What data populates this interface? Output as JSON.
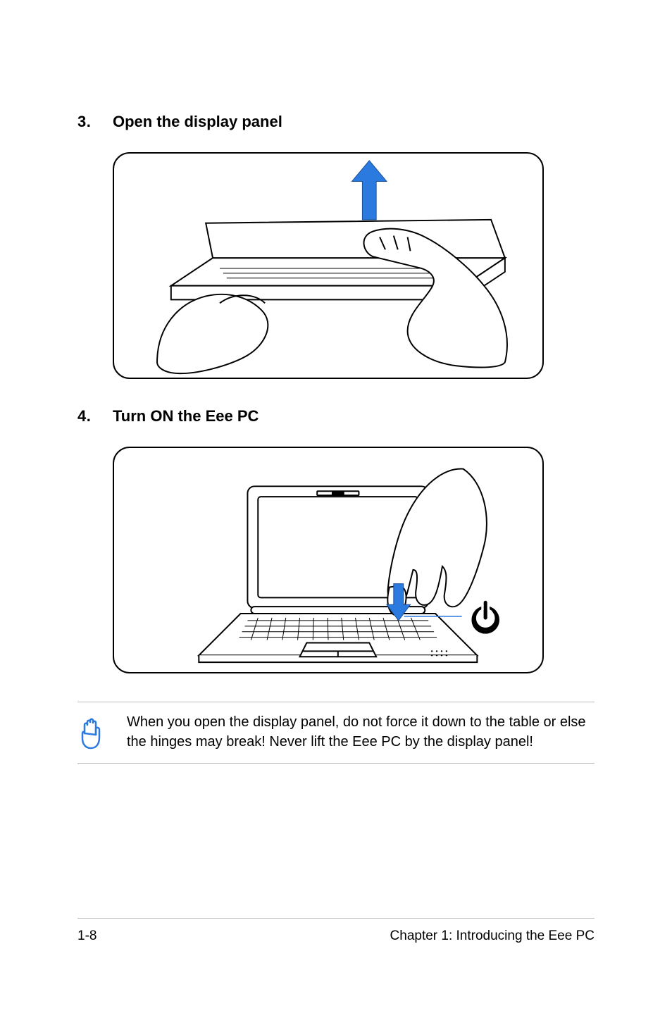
{
  "steps": [
    {
      "number": "3.",
      "title": "Open the display panel"
    },
    {
      "number": "4.",
      "title": "Turn ON the Eee PC"
    }
  ],
  "note": {
    "text": "When you open the display panel, do not force it down to the table or else the hinges may break! Never lift the Eee PC by the display panel!"
  },
  "footer": {
    "page_number": "1-8",
    "chapter_label": "Chapter 1: Introducing the Eee PC"
  },
  "icons": {
    "caution_hand": "caution-hand-icon",
    "power": "power-icon",
    "arrow_up": "arrow-up-icon",
    "arrow_down": "arrow-down-icon"
  },
  "colors": {
    "arrow_blue": "#2b7ae0",
    "icon_blue": "#2b7ae0"
  }
}
